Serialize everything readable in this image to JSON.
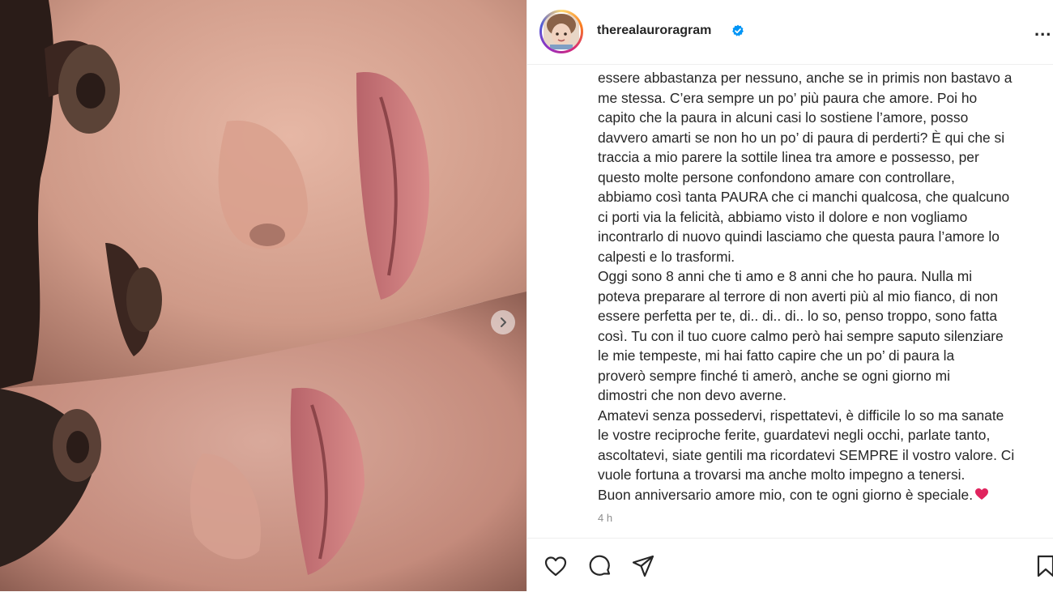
{
  "post": {
    "username": "therealauroragram",
    "verified": true,
    "more_label": "...",
    "timestamp": "4 h",
    "caption_lines": [
      "essere abbastanza per nessuno, anche se in primis non bastavo a",
      "me stessa. C’era sempre un po’ più paura che amore. Poi ho",
      "capito che la paura in alcuni casi lo sostiene l’amore, posso",
      "davvero amarti se non ho un po’ di paura di perderti? È qui che si",
      "traccia a mio parere la sottile linea tra amore e possesso, per",
      "questo molte persone confondono amare con controllare,",
      "abbiamo così tanta PAURA che ci manchi qualcosa, che qualcuno",
      "ci porti via la felicità, abbiamo visto il dolore e non vogliamo",
      "incontrarlo di nuovo quindi lasciamo che questa paura l’amore lo",
      "calpesti e lo trasformi.",
      "Oggi sono 8 anni che ti amo e 8 anni che ho paura. Nulla mi",
      "poteva preparare al terrore di non averti più al mio fianco, di non",
      "essere perfetta per te, di.. di.. di.. lo so, penso troppo, sono fatta",
      "così. Tu con il tuo cuore calmo però hai sempre saputo silenziare",
      "le mie tempeste, mi hai fatto capire che un po’ di paura la",
      "proverò sempre finché ti amerò, anche se ogni giorno mi",
      "dimostri che non devo averne.",
      "Amatevi senza possedervi, rispettatevi, è difficile lo so ma sanate",
      "le vostre reciproche ferite, guardatevi negli occhi, parlate tanto,",
      "ascoltatevi, siate gentili ma ricordatevi SEMPRE il vostro valore. Ci",
      "vuole fortuna a trovarsi ma anche molto impegno a tenersi.",
      "Buon anniversario amore mio, con te ogni giorno è speciale."
    ],
    "caption_emoji": "red-heart-emoji"
  },
  "icons": {
    "like": "heart-icon",
    "comment": "comment-bubble-icon",
    "share": "paper-plane-icon",
    "save": "bookmark-icon",
    "next": "chevron-right-icon"
  },
  "colors": {
    "verified_blue": "#0095f6",
    "timestamp_gray": "#8e8e8e",
    "heart_red": "#e0245e"
  }
}
